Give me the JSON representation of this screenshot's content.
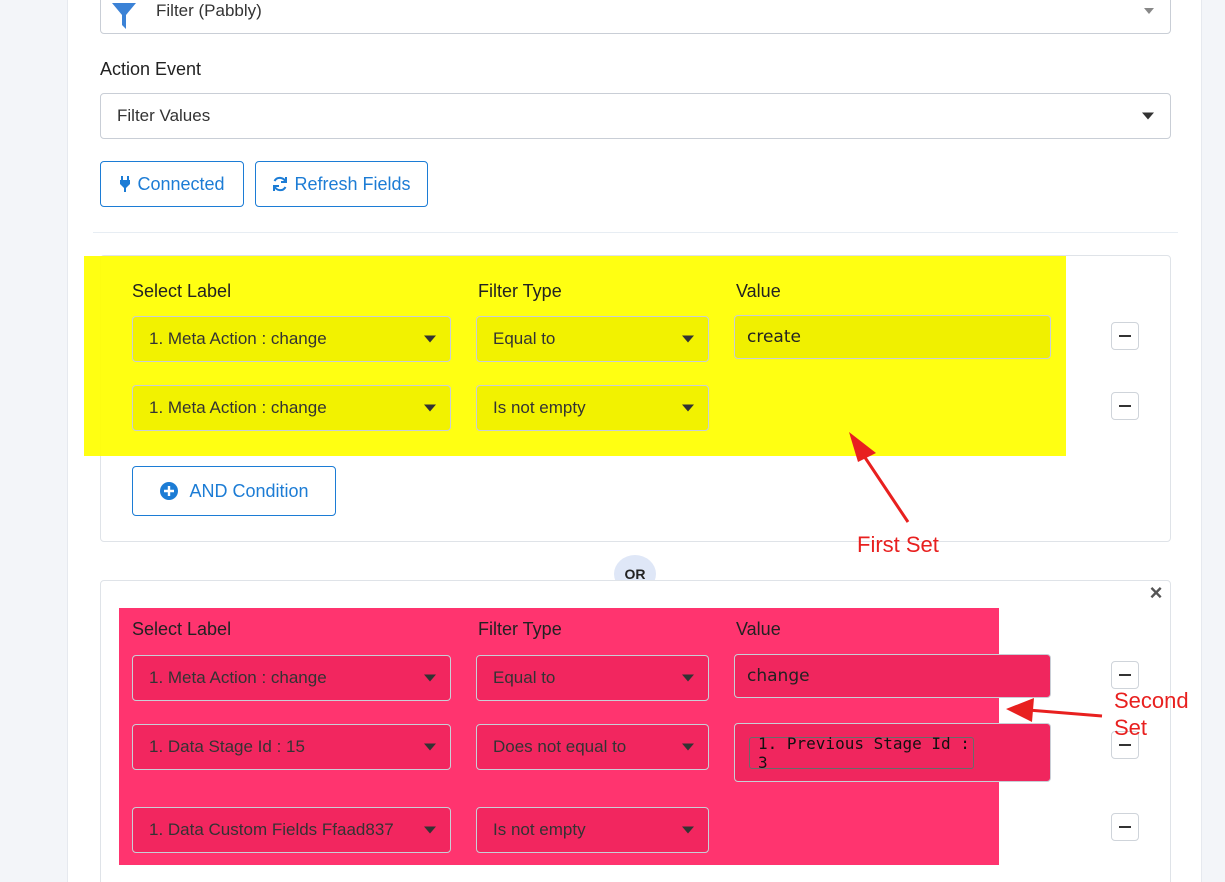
{
  "trigger": {
    "app_select_value": "Filter (Pabbly)"
  },
  "action_event": {
    "label": "Action Event",
    "select_value": "Filter Values"
  },
  "buttons": {
    "connected": "Connected",
    "refresh": "Refresh Fields",
    "and_condition": "AND Condition"
  },
  "columns": {
    "select_label": "Select Label",
    "filter_type": "Filter Type",
    "value": "Value"
  },
  "first_set": {
    "rows": [
      {
        "label": "1. Meta Action : change",
        "filter_type": "Equal to",
        "value": "create"
      },
      {
        "label": "1. Meta Action : change",
        "filter_type": "Is not empty",
        "value": ""
      }
    ]
  },
  "or_label": "OR",
  "close_glyph": "×",
  "second_set": {
    "rows": [
      {
        "label": "1. Meta Action : change",
        "filter_type": "Equal to",
        "value": "change"
      },
      {
        "label": "1. Data Stage Id : 15",
        "filter_type": "Does not equal to",
        "value": "1. Previous Stage Id : 3"
      },
      {
        "label": "1. Data Custom Fields Ffaad837",
        "filter_type": "Is not empty",
        "value": ""
      }
    ]
  },
  "annotations": {
    "first": "First Set",
    "second_line1": "Second",
    "second_line2": "Set"
  },
  "colors": {
    "highlight_yellow": "#ffff00",
    "highlight_pink": "#ff1e5f",
    "accent_blue": "#1c7cd5",
    "annotation_red": "#e8201f"
  }
}
